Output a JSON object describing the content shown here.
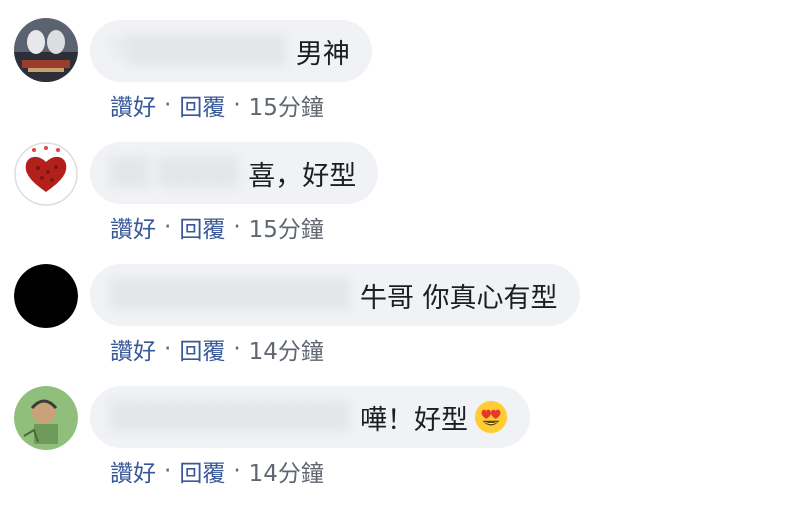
{
  "comments": [
    {
      "author": "T▒▒▒▒▒▒▒▒",
      "text": "男神",
      "like_label": "讚好",
      "reply_label": "回覆",
      "time": "15分鐘"
    },
    {
      "author": "▒▒  ▒▒▒▒",
      "text": "喜，好型",
      "like_label": "讚好",
      "reply_label": "回覆",
      "time": "15分鐘"
    },
    {
      "author": "▒▒▒▒▒▒▒▒▒▒▒▒",
      "text": "牛哥 你真心有型",
      "like_label": "讚好",
      "reply_label": "回覆",
      "time": "14分鐘"
    },
    {
      "author": "▒▒▒▒▒▒▒▒▒▒▒▒",
      "text": "嘩！好型",
      "emoji": "heart-eyes-emoji-icon",
      "like_label": "讚好",
      "reply_label": "回覆",
      "time": "14分鐘"
    }
  ],
  "separator": "·",
  "colors": {
    "bubble_bg": "#f0f2f5",
    "link": "#385898",
    "meta": "#606770",
    "text": "#1c1e21"
  }
}
